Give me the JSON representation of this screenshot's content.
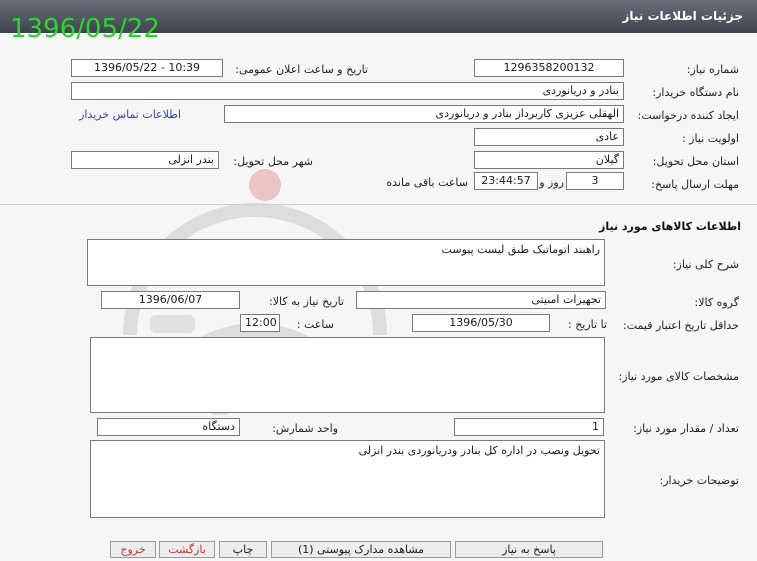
{
  "page": {
    "title": "جزئیات اطلاعات نیاز",
    "date_stamp": "1396/05/22"
  },
  "header": {
    "need_number_label": "شماره نیاز:",
    "need_number": "1296358200132",
    "announce_label": "تاریخ و ساعت اعلان عمومی:",
    "announce_value": "1396/05/22 - 10:39",
    "buyer_org_label": "نام دستگاه خریدار:",
    "buyer_org": "بنادر و دریانوردی",
    "requester_label": "ایجاد کننده درخواست:",
    "requester": "الهقلی عزیزی کاربرداز بنادر و دریانوردی",
    "contact_link": "اطلاعات تماس خریدار",
    "priority_label": "اولویت نیاز :",
    "priority": "عادی",
    "province_label": "استان محل تحویل:",
    "province": "گیلان",
    "city_label": "شهر محل تحویل:",
    "city": "بندر انزلی",
    "deadline_label": "مهلت ارسال پاسخ:",
    "deadline_days": "3",
    "days_word": "روز و",
    "deadline_time": "23:44:57",
    "remaining_word": "ساعت باقی مانده"
  },
  "goods": {
    "section_title": "اطلاعات کالاهای مورد نیاز",
    "general_desc_label": "شرح کلی نیاز:",
    "general_desc": "راهبند اتوماتیک طبق لیست پیوست",
    "group_label": "گروه کالا:",
    "group": "تجهیزات امنیتی",
    "need_date_label": "تاریخ نیاز به کالا:",
    "need_date": "1396/06/07",
    "min_validity_label": "حداقل تاریخ اعتبار قیمت:",
    "until_date_label": "تا تاریخ :",
    "until_date": "1396/05/30",
    "time_label": "ساعت :",
    "time": "12:00",
    "specs_label": "مشخصات کالای مورد نیاز:",
    "specs": "",
    "qty_label": "تعداد / مقدار مورد نیاز:",
    "qty": "1",
    "unit_label": "واحد شمارش:",
    "unit": "دستگاه",
    "buyer_notes_label": "توضیحات خریدار:",
    "buyer_notes": "تحویل ونصب در اداره کل بنادر ودریانوردی بندر انزلی"
  },
  "buttons": {
    "reply": "پاسخ به نیاز",
    "view_docs": "مشاهده مدارک پیوستی (1)",
    "print": "چاپ",
    "back": "بازگشت",
    "exit": "خروج"
  },
  "colors": {
    "titlebar": "#4a4f59",
    "date_stamp": "#2bd62b",
    "link": "#2a3fd0",
    "exit": "#c0392b"
  }
}
